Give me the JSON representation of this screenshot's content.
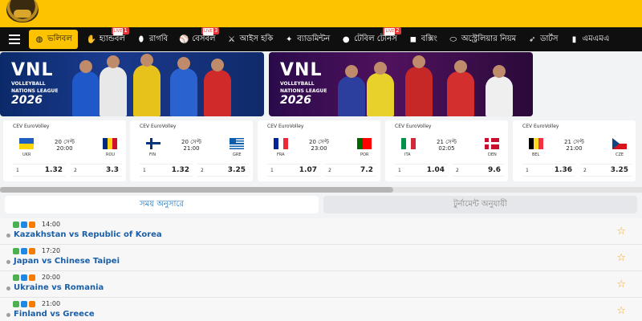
{
  "nav": {
    "items": [
      {
        "label": "ভলিবল",
        "icon": "volleyball-icon",
        "active": true
      },
      {
        "label": "হ্যান্ডবল",
        "icon": "handball-icon",
        "badge": "1"
      },
      {
        "label": "রাগবি",
        "icon": "rugby-icon"
      },
      {
        "label": "বেসবল",
        "icon": "baseball-icon",
        "badge": "3"
      },
      {
        "label": "আইস হকি",
        "icon": "ice-hockey-icon"
      },
      {
        "label": "ব্যাডমিন্টন",
        "icon": "badminton-icon"
      },
      {
        "label": "টেবিল টেনিস",
        "icon": "table-tennis-icon",
        "badge": "2"
      },
      {
        "label": "বক্সিং",
        "icon": "boxing-icon"
      },
      {
        "label": "অস্ট্রেলিয়ার নিয়ম",
        "icon": "aussie-rules-icon"
      },
      {
        "label": "ডার্টস",
        "icon": "darts-icon"
      },
      {
        "label": "এমএমএ",
        "icon": "mma-icon"
      }
    ]
  },
  "banners": {
    "left": {
      "logo": "VNL",
      "sub1": "VOLLEYBALL",
      "sub2": "NATIONS LEAGUE",
      "year": "2026"
    },
    "right": {
      "logo": "VNL",
      "sub1": "VOLLEYBALL",
      "sub2": "NATIONS LEAGUE",
      "year": "2026"
    }
  },
  "cards": [
    {
      "league": "CEV EuroVolley",
      "date": "20 সেপ্ট",
      "time": "20:00",
      "home": "UKR",
      "away": "ROU",
      "odd1_label": "1",
      "odd1": "1.32",
      "odd2_label": "2",
      "odd2": "3.3"
    },
    {
      "league": "CEV EuroVolley",
      "date": "20 সেপ্ট",
      "time": "21:00",
      "home": "FIN",
      "away": "GRE",
      "odd1_label": "1",
      "odd1": "1.32",
      "odd2_label": "2",
      "odd2": "3.25"
    },
    {
      "league": "CEV EuroVolley",
      "date": "20 সেপ্ট",
      "time": "23:00",
      "home": "FRA",
      "away": "POR",
      "odd1_label": "1",
      "odd1": "1.07",
      "odd2_label": "2",
      "odd2": "7.2"
    },
    {
      "league": "CEV EuroVolley",
      "date": "21 সেপ্ট",
      "time": "02:05",
      "home": "ITA",
      "away": "DEN",
      "odd1_label": "1",
      "odd1": "1.04",
      "odd2_label": "2",
      "odd2": "9.6"
    },
    {
      "league": "CEV EuroVolley",
      "date": "21 সেপ্ট",
      "time": "21:00",
      "home": "BEL",
      "away": "CZE",
      "odd1_label": "1",
      "odd1": "1.36",
      "odd2_label": "2",
      "odd2": "3.25"
    }
  ],
  "tabs": {
    "by_time": "সময় অনুসারে",
    "by_tournament": "টুর্নামেন্ট অনুযায়ী"
  },
  "matches": [
    {
      "time": "14:00",
      "title": "Kazakhstan vs Republic of Korea"
    },
    {
      "time": "17:20",
      "title": "Japan vs Chinese Taipei"
    },
    {
      "time": "20:00",
      "title": "Ukraine vs Romania"
    },
    {
      "time": "21:00",
      "title": "Finland vs Greece"
    }
  ],
  "colors": {
    "brand_yellow": "#fdc300",
    "nav_bg": "#0f0f0f",
    "link_blue": "#1a5fa8",
    "star": "#f5a623"
  }
}
